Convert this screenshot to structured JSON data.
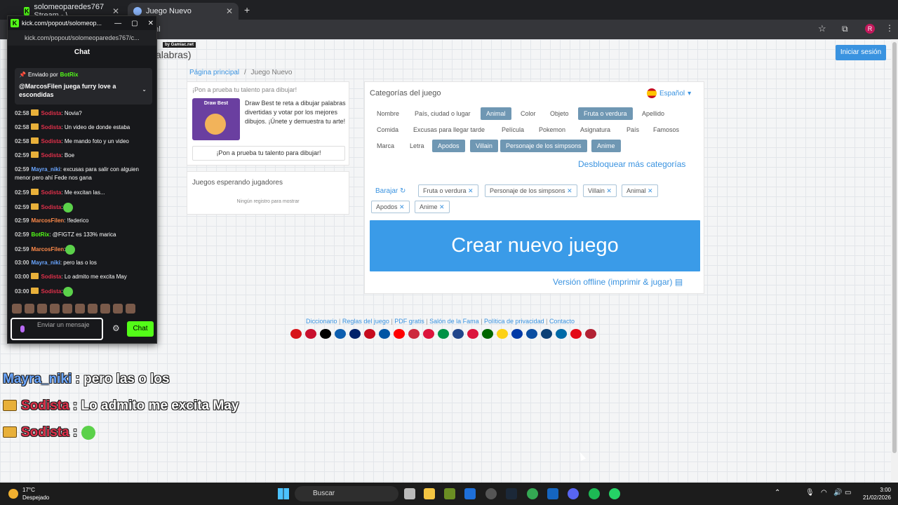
{
  "browser": {
    "tabs": [
      {
        "title": "solomeoparedes767 Stream - \\"
      },
      {
        "title": "Juego Nuevo"
      }
    ],
    "address_tail": "tml",
    "profile_letter": "R"
  },
  "page": {
    "header_partial": "alabras)",
    "badge": "by Gamiac.net",
    "login": "Iniciar sesión",
    "breadcrumb": {
      "home": "Página principal",
      "sep": "/",
      "current": "Juego Nuevo"
    },
    "promo": {
      "heading": "¡Pon a prueba tu talento para dibujar!",
      "image_title": "Draw Best",
      "text": "Draw Best te reta a dibujar palabras divertidas y votar por los mejores dibujos. ¡Únete y demuestra tu arte!",
      "button": "¡Pon a prueba tu talento para dibujar!"
    },
    "waiting": {
      "heading": "Juegos esperando jugadores",
      "empty": "Ningún registro para mostrar"
    },
    "categories": {
      "title": "Categorías del juego",
      "language": "Español",
      "items": [
        {
          "label": "Nombre",
          "selected": false
        },
        {
          "label": "País, ciudad o lugar",
          "selected": false
        },
        {
          "label": "Animal",
          "selected": true
        },
        {
          "label": "Color",
          "selected": false
        },
        {
          "label": "Objeto",
          "selected": false
        },
        {
          "label": "Fruta o verdura",
          "selected": true
        },
        {
          "label": "Apellido",
          "selected": false
        },
        {
          "label": "Comida",
          "selected": false
        },
        {
          "label": "Excusas para llegar tarde",
          "selected": false
        },
        {
          "label": "Película",
          "selected": false
        },
        {
          "label": "Pokemon",
          "selected": false
        },
        {
          "label": "Asignatura",
          "selected": false
        },
        {
          "label": "País",
          "selected": false
        },
        {
          "label": "Famosos",
          "selected": false
        },
        {
          "label": "Marca",
          "selected": false
        },
        {
          "label": "Letra",
          "selected": false
        },
        {
          "label": "Apodos",
          "selected": true
        },
        {
          "label": "Villain",
          "selected": true
        },
        {
          "label": "Personaje de los simpsons",
          "selected": true
        },
        {
          "label": "Anime",
          "selected": true
        }
      ],
      "unlock": "Desbloquear más categorías",
      "shuffle": "Barajar",
      "selected_tags": [
        "Fruta o verdura",
        "Personaje de los simpsons",
        "Villain",
        "Animal",
        "Apodos",
        "Anime"
      ],
      "create_button": "Crear nuevo juego",
      "offline": "Versión offline (imprimir & jugar)"
    },
    "footer_links": [
      "Diccionario",
      "Reglas del juego",
      "PDF gratis",
      "Salón de la Fama",
      "Política de privacidad",
      "Contacto"
    ],
    "flag_colors": [
      "#d7141a",
      "#c8102e",
      "#000000",
      "#0d5eaf",
      "#012169",
      "#c60b1e",
      "#0055a4",
      "#ff0000",
      "#cd2a3e",
      "#dc143c",
      "#009246",
      "#21468b",
      "#dc143c",
      "#006600",
      "#fcd116",
      "#0039a6",
      "#0b4ea2",
      "#0c4076",
      "#006aa7",
      "#e30a17",
      "#b22234"
    ]
  },
  "kick": {
    "window_title": "kick.com/popout/solomeop...",
    "url": "kick.com/popout/solomeoparedes767/c...",
    "chat_heading": "Chat",
    "pinned": {
      "sent_by": "Enviado por",
      "sender": "BotRix",
      "message": "@MarcosFilen juega furry love a escondidas"
    },
    "messages": [
      {
        "time": "02:58",
        "user": "Sodista",
        "cls": "sod",
        "crown": true,
        "text": ": Novia?"
      },
      {
        "time": "02:58",
        "user": "Sodista",
        "cls": "sod",
        "crown": true,
        "text": ": Un video de donde estaba"
      },
      {
        "time": "02:58",
        "user": "Sodista",
        "cls": "sod",
        "crown": true,
        "text": ": Me mando foto y un video"
      },
      {
        "time": "02:59",
        "user": "Sodista",
        "cls": "sod",
        "crown": true,
        "text": ": Boe"
      },
      {
        "time": "02:59",
        "user": "Mayra_niki",
        "cls": "may",
        "crown": false,
        "text": ": excusas para salir con alguien menor pero ahí Fede nos gana"
      },
      {
        "time": "02:59",
        "user": "Sodista",
        "cls": "sod",
        "crown": true,
        "text": ": Me excitan las..."
      },
      {
        "time": "02:59",
        "user": "Sodista",
        "cls": "sod",
        "crown": true,
        "text": ":"
      },
      {
        "time": "02:59",
        "user": "MarcosFilen",
        "cls": "mar",
        "crown": false,
        "text": ": !federico"
      },
      {
        "time": "02:59",
        "user": "BotRix",
        "cls": "bot",
        "crown": false,
        "text": ": @FIGTZ es 133% marica"
      },
      {
        "time": "02:59",
        "user": "MarcosFilen",
        "cls": "mar",
        "crown": false,
        "text": ":"
      },
      {
        "time": "03:00",
        "user": "Mayra_niki",
        "cls": "may",
        "crown": false,
        "text": ": pero las o los"
      },
      {
        "time": "03:00",
        "user": "Sodista",
        "cls": "sod",
        "crown": true,
        "text": ": Lo admito me excita May"
      },
      {
        "time": "03:00",
        "user": "Sodista",
        "cls": "sod",
        "crown": true,
        "text": ":"
      }
    ],
    "input_placeholder": "Enviar un mensaje",
    "send_button": "Chat"
  },
  "overlay": [
    {
      "user": "Mayra_niki",
      "text": " : pero las o los",
      "crown": false
    },
    {
      "user": "Sodista",
      "text": " : Lo admito me excita May",
      "crown": true
    },
    {
      "user": "Sodista",
      "text": " : ",
      "crown": true
    }
  ],
  "taskbar": {
    "temp": "17°C",
    "weather": "Despejado",
    "search": "Buscar",
    "time": "3:00",
    "date": "21/02/2026"
  }
}
